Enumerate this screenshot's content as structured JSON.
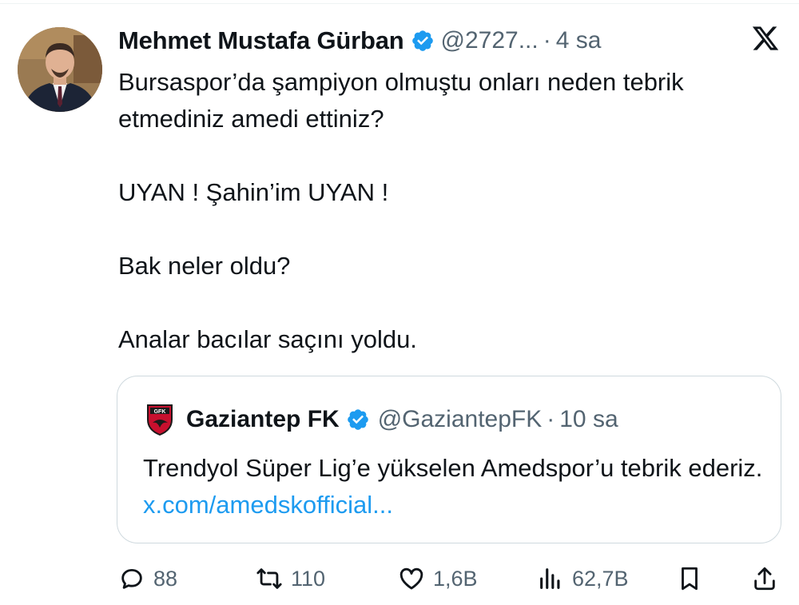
{
  "tweet": {
    "author_name": "Mehmet Mustafa Gürban",
    "handle": "@2727...",
    "separator": "·",
    "time": "4 sa",
    "paragraphs": [
      "Bursaspor’da şampiyon olmuştu onları neden tebrik etmediniz amedi ettiniz?",
      "UYAN ! Şahin’im UYAN !",
      "Bak neler oldu?",
      "Analar bacılar saçını yoldu."
    ]
  },
  "quoted": {
    "logo_text": "GFK",
    "author_name": "Gaziantep FK",
    "handle": "@GaziantepFK",
    "separator": "·",
    "time": "10 sa",
    "text": "Trendyol Süper Lig’e yükselen Amedspor’u tebrik ederiz.",
    "link": "x.com/amedskofficial..."
  },
  "actions": {
    "replies": "88",
    "reposts": "110",
    "likes": "1,6B",
    "views": "62,7B"
  },
  "colors": {
    "verified": "#1d9bf0",
    "secondary_text": "#536471",
    "link": "#1d9bf0"
  },
  "icons": [
    "verified-badge-icon",
    "x-logo-icon",
    "reply-icon",
    "repost-icon",
    "like-icon",
    "views-icon",
    "bookmark-icon",
    "share-icon"
  ]
}
